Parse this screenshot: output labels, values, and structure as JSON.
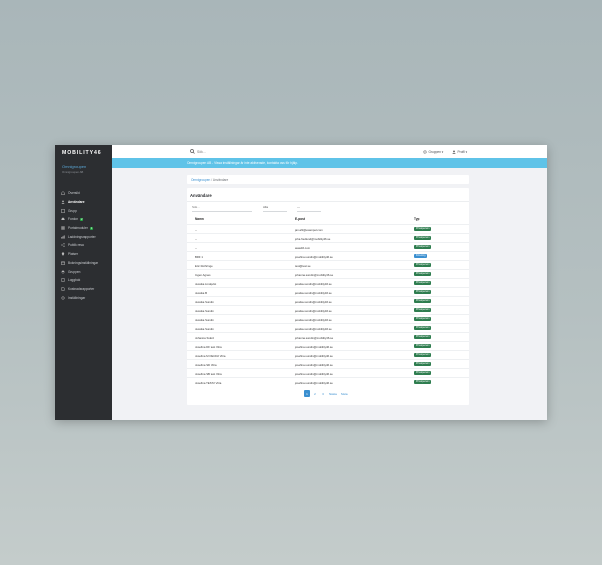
{
  "sidebar": {
    "logo": "MOBILITY46",
    "org_name": "Omnigroupen",
    "org_sub": "Omnigroupen AB",
    "items": [
      {
        "label": "Översikt",
        "icon": "home-icon"
      },
      {
        "label": "Användare",
        "icon": "user-icon"
      },
      {
        "label": "Grupp",
        "icon": "group-icon"
      },
      {
        "label": "Fordon",
        "icon": "car-icon",
        "badge": "2"
      },
      {
        "label": "Portalmoduler",
        "icon": "module-icon",
        "badge": "1"
      },
      {
        "label": "Laddningsrapporter",
        "icon": "chart-icon"
      },
      {
        "label": "Publik resa",
        "icon": "share-icon"
      },
      {
        "label": "Platser",
        "icon": "location-icon"
      },
      {
        "label": "Bokningsinställningar",
        "icon": "calendar-icon"
      },
      {
        "label": "Gruppen",
        "icon": "layers-icon"
      },
      {
        "label": "Loggbok",
        "icon": "book-icon"
      },
      {
        "label": "Kostnadsrapporter",
        "icon": "document-icon"
      },
      {
        "label": "Inställningar",
        "icon": "gear-icon"
      }
    ]
  },
  "topbar": {
    "search_placeholder": "Sök...",
    "btn_settings": "Gruppen ▾",
    "btn_user": "Profil ▾"
  },
  "notice": {
    "text": "Omnigroupen AB - Vissa inställningar är inte aktiverade, kontakta oss för hjälp."
  },
  "breadcrumb": {
    "home": "Omnigroupen",
    "current": "Användare"
  },
  "card": {
    "title": "Användare",
    "filter_name_placeholder": "Sök...",
    "filter_group": "Alla",
    "filter_type": "---"
  },
  "table": {
    "headers": {
      "name": "Namn",
      "email": "E-post",
      "type": "Typ"
    },
    "rows": [
      {
        "name": "--",
        "email": "jan.ahl@exampel.com",
        "type": "Privatperson",
        "type_color": "#2e7d4f"
      },
      {
        "name": "--",
        "email": "joha.frediund@mobility46.se",
        "type": "Privatperson",
        "type_color": "#2e7d4f"
      },
      {
        "name": "--",
        "email": "asas46.com",
        "type": "Privatperson",
        "type_color": "#2e7d4f"
      },
      {
        "name": "BRF 1",
        "email": "josefina.sundin@mobility46.se",
        "type": "Förening",
        "type_color": "#3a8fd0"
      },
      {
        "name": "Eric Rothringe",
        "email": "test@test.se",
        "type": "Privatperson",
        "type_color": "#2e7d4f"
      },
      {
        "name": "Ingen Agnes",
        "email": "johanna.sundin@mobility46.se",
        "type": "Privatperson",
        "type_color": "#2e7d4f"
      },
      {
        "name": "Jessika Lindqvist",
        "email": "jessika.sundin@mobility46.se",
        "type": "Privatperson",
        "type_color": "#2e7d4f"
      },
      {
        "name": "Jessika B",
        "email": "jessika.sundin@mobility46.se",
        "type": "Privatperson",
        "type_color": "#2e7d4f"
      },
      {
        "name": "Jessika Sundin",
        "email": "jessika.sundin@mobility46.se",
        "type": "Privatperson",
        "type_color": "#2e7d4f"
      },
      {
        "name": "Jessika Sundin",
        "email": "jessika.sundin@mobility46.se",
        "type": "Privatperson",
        "type_color": "#2e7d4f"
      },
      {
        "name": "Jessika Sundin",
        "email": "jessika.sundin@mobility46.se",
        "type": "Privatperson",
        "type_color": "#2e7d4f"
      },
      {
        "name": "Jessika Sundin",
        "email": "jessika.sundin@mobility46.se",
        "type": "Privatperson",
        "type_color": "#2e7d4f"
      },
      {
        "name": "Johanna Svärd",
        "email": "johanna.sundin@mobility46.se",
        "type": "Privatperson",
        "type_color": "#2e7d4f"
      },
      {
        "name": "Josefina DF test Vitra",
        "email": "josefina.sundin@mobility46.se",
        "type": "Privatperson",
        "type_color": "#2e7d4f"
      },
      {
        "name": "Josefina M OECD2 Vitra",
        "email": "josefina.sundin@mobility46.se",
        "type": "Privatperson",
        "type_color": "#2e7d4f"
      },
      {
        "name": "Josefina SD Vitra",
        "email": "josefina.sundin@mobility46.se",
        "type": "Privatperson",
        "type_color": "#2e7d4f"
      },
      {
        "name": "Josefina SB test Vitra",
        "email": "josefina.sundin@mobility46.se",
        "type": "Privatperson",
        "type_color": "#2e7d4f"
      },
      {
        "name": "Josefina TEST2 Vitra",
        "email": "josefina.sundin@mobility46.se",
        "type": "Privatperson",
        "type_color": "#2e7d4f"
      }
    ]
  },
  "pagination": {
    "pages": [
      "1",
      "2",
      "3"
    ],
    "next": "Nästa",
    "last": "Sista"
  }
}
